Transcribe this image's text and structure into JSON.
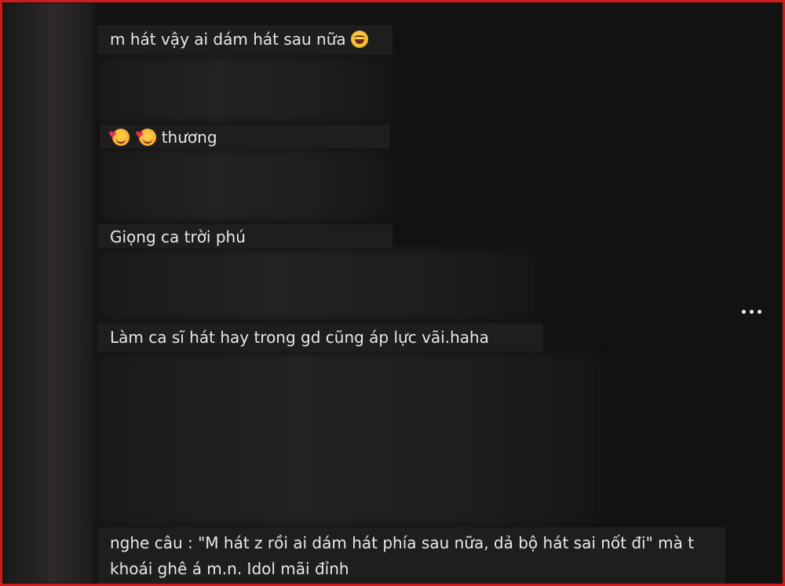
{
  "comments": [
    {
      "text": "m hát vậy ai dám hát sau nữa",
      "emoji": "face-with-tears-of-joy"
    },
    {
      "text": "thương",
      "emoji": "smiling-face-with-hearts"
    },
    {
      "text": "Giọng ca trời phú"
    },
    {
      "text": "Làm ca sĩ hát hay trong gd cũng áp lực vãi.haha"
    },
    {
      "text": "nghe câu : \"M hát z rồi ai dám hát phía sau nữa, dả bộ hát sai nốt đi\" mà t khoái ghê á m.n. Idol mãi đỉnh"
    }
  ],
  "more_options": {
    "icon": "more-horizontal-icon"
  },
  "colors": {
    "border": "#d11a1a",
    "background": "#121212",
    "comment_bg": "#1e1e1e",
    "text": "#e8e8e8"
  }
}
